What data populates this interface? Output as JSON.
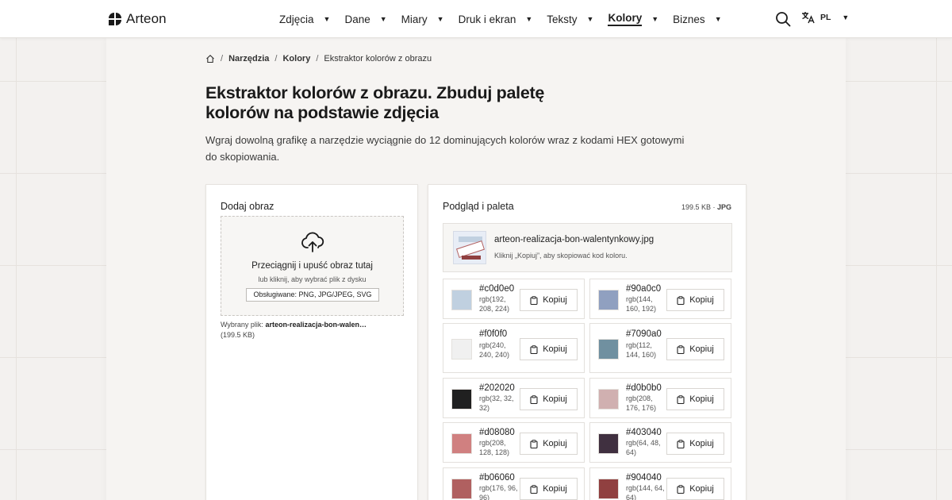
{
  "header": {
    "brand": "Arteon",
    "nav": [
      {
        "label": "Zdjęcia",
        "active": false
      },
      {
        "label": "Dane",
        "active": false
      },
      {
        "label": "Miary",
        "active": false
      },
      {
        "label": "Druk i ekran",
        "active": false
      },
      {
        "label": "Teksty",
        "active": false
      },
      {
        "label": "Kolory",
        "active": true
      },
      {
        "label": "Biznes",
        "active": false
      }
    ],
    "search_icon": "search-icon",
    "lang_icon": "translate-icon",
    "lang_code": "PL"
  },
  "breadcrumb": {
    "home_icon": "home-icon",
    "items": [
      "Narzędzia",
      "Kolory",
      "Ekstraktor kolorów z obrazu"
    ]
  },
  "page": {
    "title": "Ekstraktor kolorów z obrazu. Zbuduj paletę kolorów na podstawie zdjęcia",
    "lead": "Wgraj dowolną grafikę a narzędzie wyciągnie do 12 dominujących kolorów wraz z kodami HEX gotowymi do skopiowania."
  },
  "upload": {
    "title": "Dodaj obraz",
    "drop_title": "Przeciągnij i upuść obraz tutaj",
    "drop_sub": "lub kliknij, aby wybrać plik z dysku",
    "formats": "Obsługiwane: PNG, JPG/JPEG, SVG",
    "chosen_label": "Wybrany plik:",
    "chosen_file": "arteon-realizacja-bon-walen…",
    "chosen_size": "(199.5 KB)"
  },
  "preview": {
    "title": "Podgląd i paleta",
    "size": "199.5 KB",
    "format": "JPG",
    "file_name": "arteon-realizacja-bon-walentynkowy.jpg",
    "hint": "Kliknij „Kopiuj”, aby skopiować kod koloru.",
    "copy_label": "Kopiuj",
    "swatches": [
      {
        "hex": "#c0d0e0",
        "rgb": "rgb(192, 208, 224)"
      },
      {
        "hex": "#90a0c0",
        "rgb": "rgb(144, 160, 192)"
      },
      {
        "hex": "#f0f0f0",
        "rgb": "rgb(240, 240, 240)"
      },
      {
        "hex": "#7090a0",
        "rgb": "rgb(112, 144, 160)"
      },
      {
        "hex": "#202020",
        "rgb": "rgb(32, 32, 32)"
      },
      {
        "hex": "#d0b0b0",
        "rgb": "rgb(208, 176, 176)"
      },
      {
        "hex": "#d08080",
        "rgb": "rgb(208, 128, 128)"
      },
      {
        "hex": "#403040",
        "rgb": "rgb(64, 48, 64)"
      },
      {
        "hex": "#b06060",
        "rgb": "rgb(176, 96, 96)"
      },
      {
        "hex": "#904040",
        "rgb": "rgb(144, 64, 64)"
      }
    ]
  }
}
